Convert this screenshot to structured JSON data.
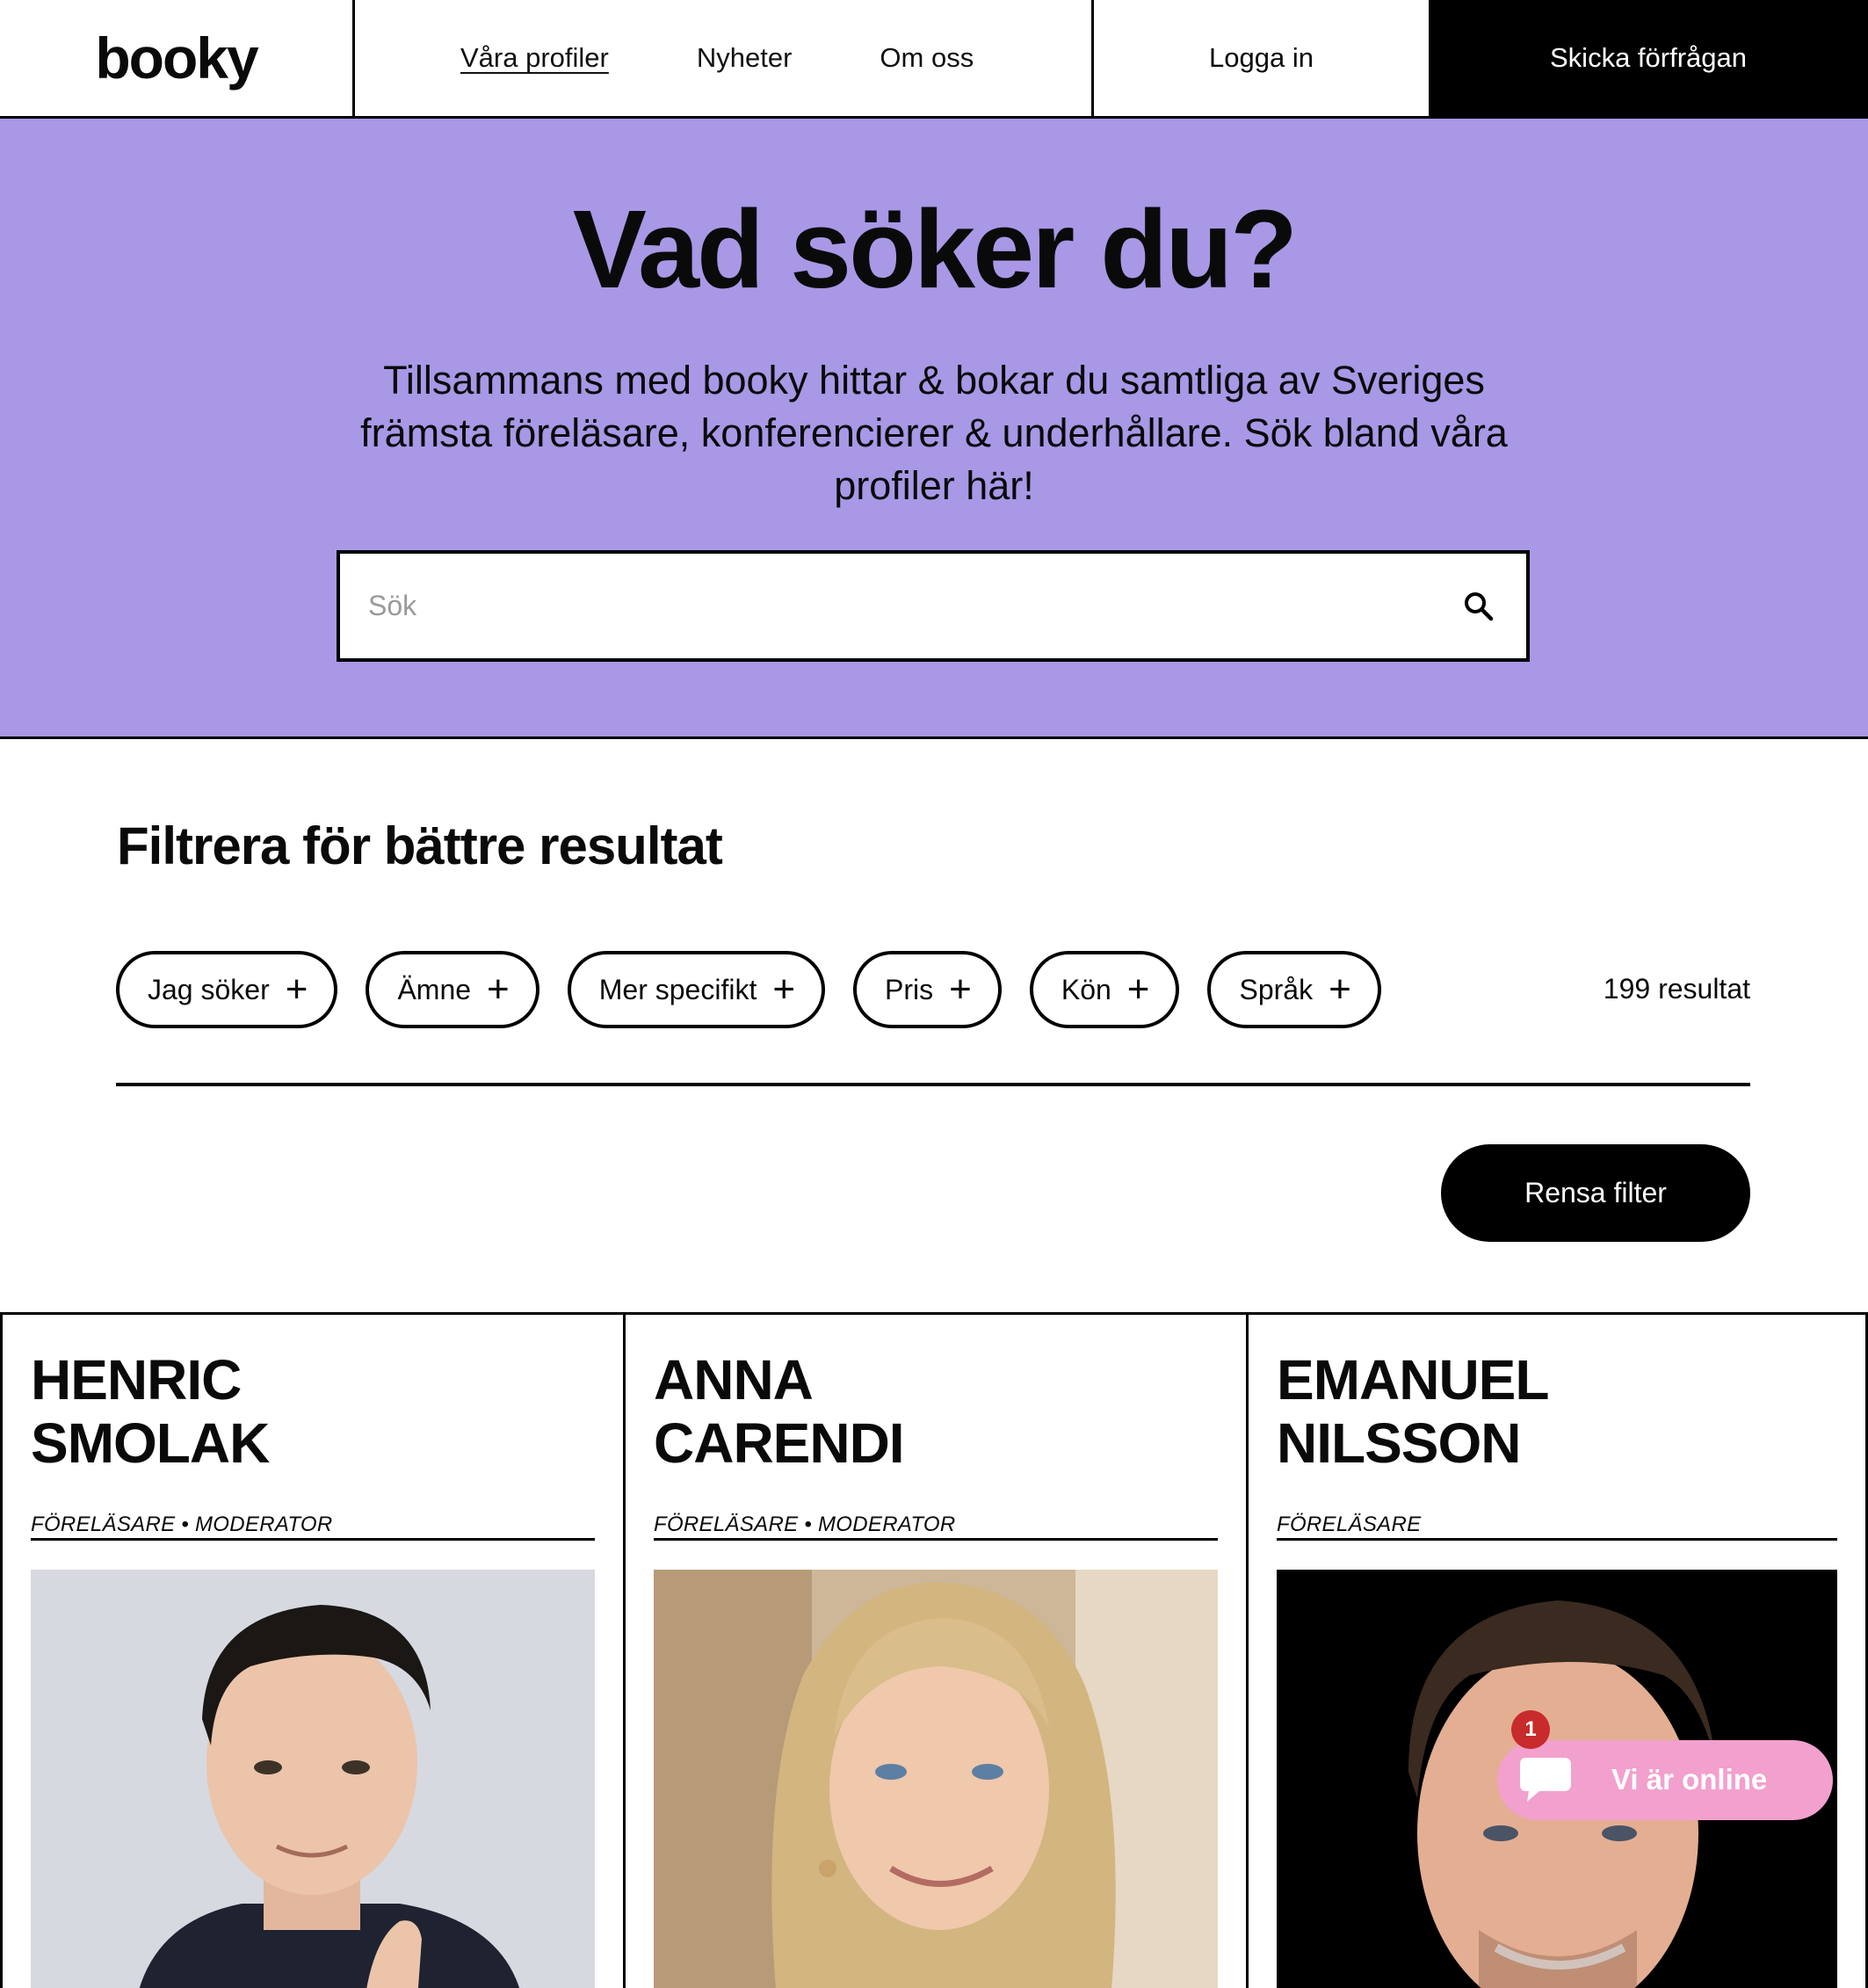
{
  "nav": {
    "logo": "booky",
    "links": [
      {
        "label": "Våra profiler",
        "active": true
      },
      {
        "label": "Nyheter",
        "active": false
      },
      {
        "label": "Om oss",
        "active": false
      }
    ],
    "login_label": "Logga in",
    "cta_label": "Skicka förfrågan"
  },
  "hero": {
    "title": "Vad söker du?",
    "text": "Tillsammans med booky hittar & bokar du samtliga av Sveriges främsta föreläsare, konferencierer & underhållare. Sök bland våra profiler här!",
    "search_placeholder": "Sök",
    "search_value": "",
    "background_color": "#a898e6"
  },
  "filter": {
    "title": "Filtrera för bättre resultat",
    "chips": [
      {
        "label": "Jag söker",
        "icon": "plus-icon"
      },
      {
        "label": "Ämne",
        "icon": "plus-icon"
      },
      {
        "label": "Mer specifikt",
        "icon": "plus-icon"
      },
      {
        "label": "Pris",
        "icon": "plus-icon"
      },
      {
        "label": "Kön",
        "icon": "plus-icon"
      },
      {
        "label": "Språk",
        "icon": "plus-icon"
      }
    ],
    "results": "199 resultat",
    "clear_label": "Rensa filter"
  },
  "profiles": [
    {
      "first": "HENRIC",
      "last": "SMOLAK",
      "roles": "FÖRELÄSARE • MODERATOR",
      "photo": "portrait-man-dark-hair"
    },
    {
      "first": "ANNA",
      "last": "CARENDI",
      "roles": "FÖRELÄSARE • MODERATOR",
      "photo": "portrait-woman-blonde"
    },
    {
      "first": "EMANUEL",
      "last": "NILSSON",
      "roles": "FÖRELÄSARE",
      "photo": "portrait-man-black-background"
    }
  ],
  "chat": {
    "label": "Vi är online",
    "badge_count": "1",
    "color": "#f2a0cd",
    "icon": "chat-bubble-icon"
  }
}
